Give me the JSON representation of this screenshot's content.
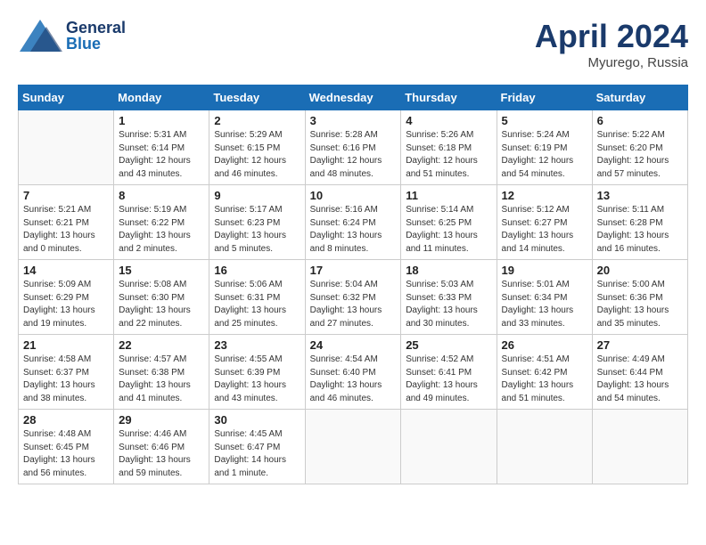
{
  "header": {
    "logo_general": "General",
    "logo_blue": "Blue",
    "month_year": "April 2024",
    "location": "Myurego, Russia"
  },
  "calendar": {
    "headers": [
      "Sunday",
      "Monday",
      "Tuesday",
      "Wednesday",
      "Thursday",
      "Friday",
      "Saturday"
    ],
    "weeks": [
      [
        {
          "day": "",
          "sunrise": "",
          "sunset": "",
          "daylight": ""
        },
        {
          "day": "1",
          "sunrise": "Sunrise: 5:31 AM",
          "sunset": "Sunset: 6:14 PM",
          "daylight": "Daylight: 12 hours and 43 minutes."
        },
        {
          "day": "2",
          "sunrise": "Sunrise: 5:29 AM",
          "sunset": "Sunset: 6:15 PM",
          "daylight": "Daylight: 12 hours and 46 minutes."
        },
        {
          "day": "3",
          "sunrise": "Sunrise: 5:28 AM",
          "sunset": "Sunset: 6:16 PM",
          "daylight": "Daylight: 12 hours and 48 minutes."
        },
        {
          "day": "4",
          "sunrise": "Sunrise: 5:26 AM",
          "sunset": "Sunset: 6:18 PM",
          "daylight": "Daylight: 12 hours and 51 minutes."
        },
        {
          "day": "5",
          "sunrise": "Sunrise: 5:24 AM",
          "sunset": "Sunset: 6:19 PM",
          "daylight": "Daylight: 12 hours and 54 minutes."
        },
        {
          "day": "6",
          "sunrise": "Sunrise: 5:22 AM",
          "sunset": "Sunset: 6:20 PM",
          "daylight": "Daylight: 12 hours and 57 minutes."
        }
      ],
      [
        {
          "day": "7",
          "sunrise": "Sunrise: 5:21 AM",
          "sunset": "Sunset: 6:21 PM",
          "daylight": "Daylight: 13 hours and 0 minutes."
        },
        {
          "day": "8",
          "sunrise": "Sunrise: 5:19 AM",
          "sunset": "Sunset: 6:22 PM",
          "daylight": "Daylight: 13 hours and 2 minutes."
        },
        {
          "day": "9",
          "sunrise": "Sunrise: 5:17 AM",
          "sunset": "Sunset: 6:23 PM",
          "daylight": "Daylight: 13 hours and 5 minutes."
        },
        {
          "day": "10",
          "sunrise": "Sunrise: 5:16 AM",
          "sunset": "Sunset: 6:24 PM",
          "daylight": "Daylight: 13 hours and 8 minutes."
        },
        {
          "day": "11",
          "sunrise": "Sunrise: 5:14 AM",
          "sunset": "Sunset: 6:25 PM",
          "daylight": "Daylight: 13 hours and 11 minutes."
        },
        {
          "day": "12",
          "sunrise": "Sunrise: 5:12 AM",
          "sunset": "Sunset: 6:27 PM",
          "daylight": "Daylight: 13 hours and 14 minutes."
        },
        {
          "day": "13",
          "sunrise": "Sunrise: 5:11 AM",
          "sunset": "Sunset: 6:28 PM",
          "daylight": "Daylight: 13 hours and 16 minutes."
        }
      ],
      [
        {
          "day": "14",
          "sunrise": "Sunrise: 5:09 AM",
          "sunset": "Sunset: 6:29 PM",
          "daylight": "Daylight: 13 hours and 19 minutes."
        },
        {
          "day": "15",
          "sunrise": "Sunrise: 5:08 AM",
          "sunset": "Sunset: 6:30 PM",
          "daylight": "Daylight: 13 hours and 22 minutes."
        },
        {
          "day": "16",
          "sunrise": "Sunrise: 5:06 AM",
          "sunset": "Sunset: 6:31 PM",
          "daylight": "Daylight: 13 hours and 25 minutes."
        },
        {
          "day": "17",
          "sunrise": "Sunrise: 5:04 AM",
          "sunset": "Sunset: 6:32 PM",
          "daylight": "Daylight: 13 hours and 27 minutes."
        },
        {
          "day": "18",
          "sunrise": "Sunrise: 5:03 AM",
          "sunset": "Sunset: 6:33 PM",
          "daylight": "Daylight: 13 hours and 30 minutes."
        },
        {
          "day": "19",
          "sunrise": "Sunrise: 5:01 AM",
          "sunset": "Sunset: 6:34 PM",
          "daylight": "Daylight: 13 hours and 33 minutes."
        },
        {
          "day": "20",
          "sunrise": "Sunrise: 5:00 AM",
          "sunset": "Sunset: 6:36 PM",
          "daylight": "Daylight: 13 hours and 35 minutes."
        }
      ],
      [
        {
          "day": "21",
          "sunrise": "Sunrise: 4:58 AM",
          "sunset": "Sunset: 6:37 PM",
          "daylight": "Daylight: 13 hours and 38 minutes."
        },
        {
          "day": "22",
          "sunrise": "Sunrise: 4:57 AM",
          "sunset": "Sunset: 6:38 PM",
          "daylight": "Daylight: 13 hours and 41 minutes."
        },
        {
          "day": "23",
          "sunrise": "Sunrise: 4:55 AM",
          "sunset": "Sunset: 6:39 PM",
          "daylight": "Daylight: 13 hours and 43 minutes."
        },
        {
          "day": "24",
          "sunrise": "Sunrise: 4:54 AM",
          "sunset": "Sunset: 6:40 PM",
          "daylight": "Daylight: 13 hours and 46 minutes."
        },
        {
          "day": "25",
          "sunrise": "Sunrise: 4:52 AM",
          "sunset": "Sunset: 6:41 PM",
          "daylight": "Daylight: 13 hours and 49 minutes."
        },
        {
          "day": "26",
          "sunrise": "Sunrise: 4:51 AM",
          "sunset": "Sunset: 6:42 PM",
          "daylight": "Daylight: 13 hours and 51 minutes."
        },
        {
          "day": "27",
          "sunrise": "Sunrise: 4:49 AM",
          "sunset": "Sunset: 6:44 PM",
          "daylight": "Daylight: 13 hours and 54 minutes."
        }
      ],
      [
        {
          "day": "28",
          "sunrise": "Sunrise: 4:48 AM",
          "sunset": "Sunset: 6:45 PM",
          "daylight": "Daylight: 13 hours and 56 minutes."
        },
        {
          "day": "29",
          "sunrise": "Sunrise: 4:46 AM",
          "sunset": "Sunset: 6:46 PM",
          "daylight": "Daylight: 13 hours and 59 minutes."
        },
        {
          "day": "30",
          "sunrise": "Sunrise: 4:45 AM",
          "sunset": "Sunset: 6:47 PM",
          "daylight": "Daylight: 14 hours and 1 minute."
        },
        {
          "day": "",
          "sunrise": "",
          "sunset": "",
          "daylight": ""
        },
        {
          "day": "",
          "sunrise": "",
          "sunset": "",
          "daylight": ""
        },
        {
          "day": "",
          "sunrise": "",
          "sunset": "",
          "daylight": ""
        },
        {
          "day": "",
          "sunrise": "",
          "sunset": "",
          "daylight": ""
        }
      ]
    ]
  }
}
